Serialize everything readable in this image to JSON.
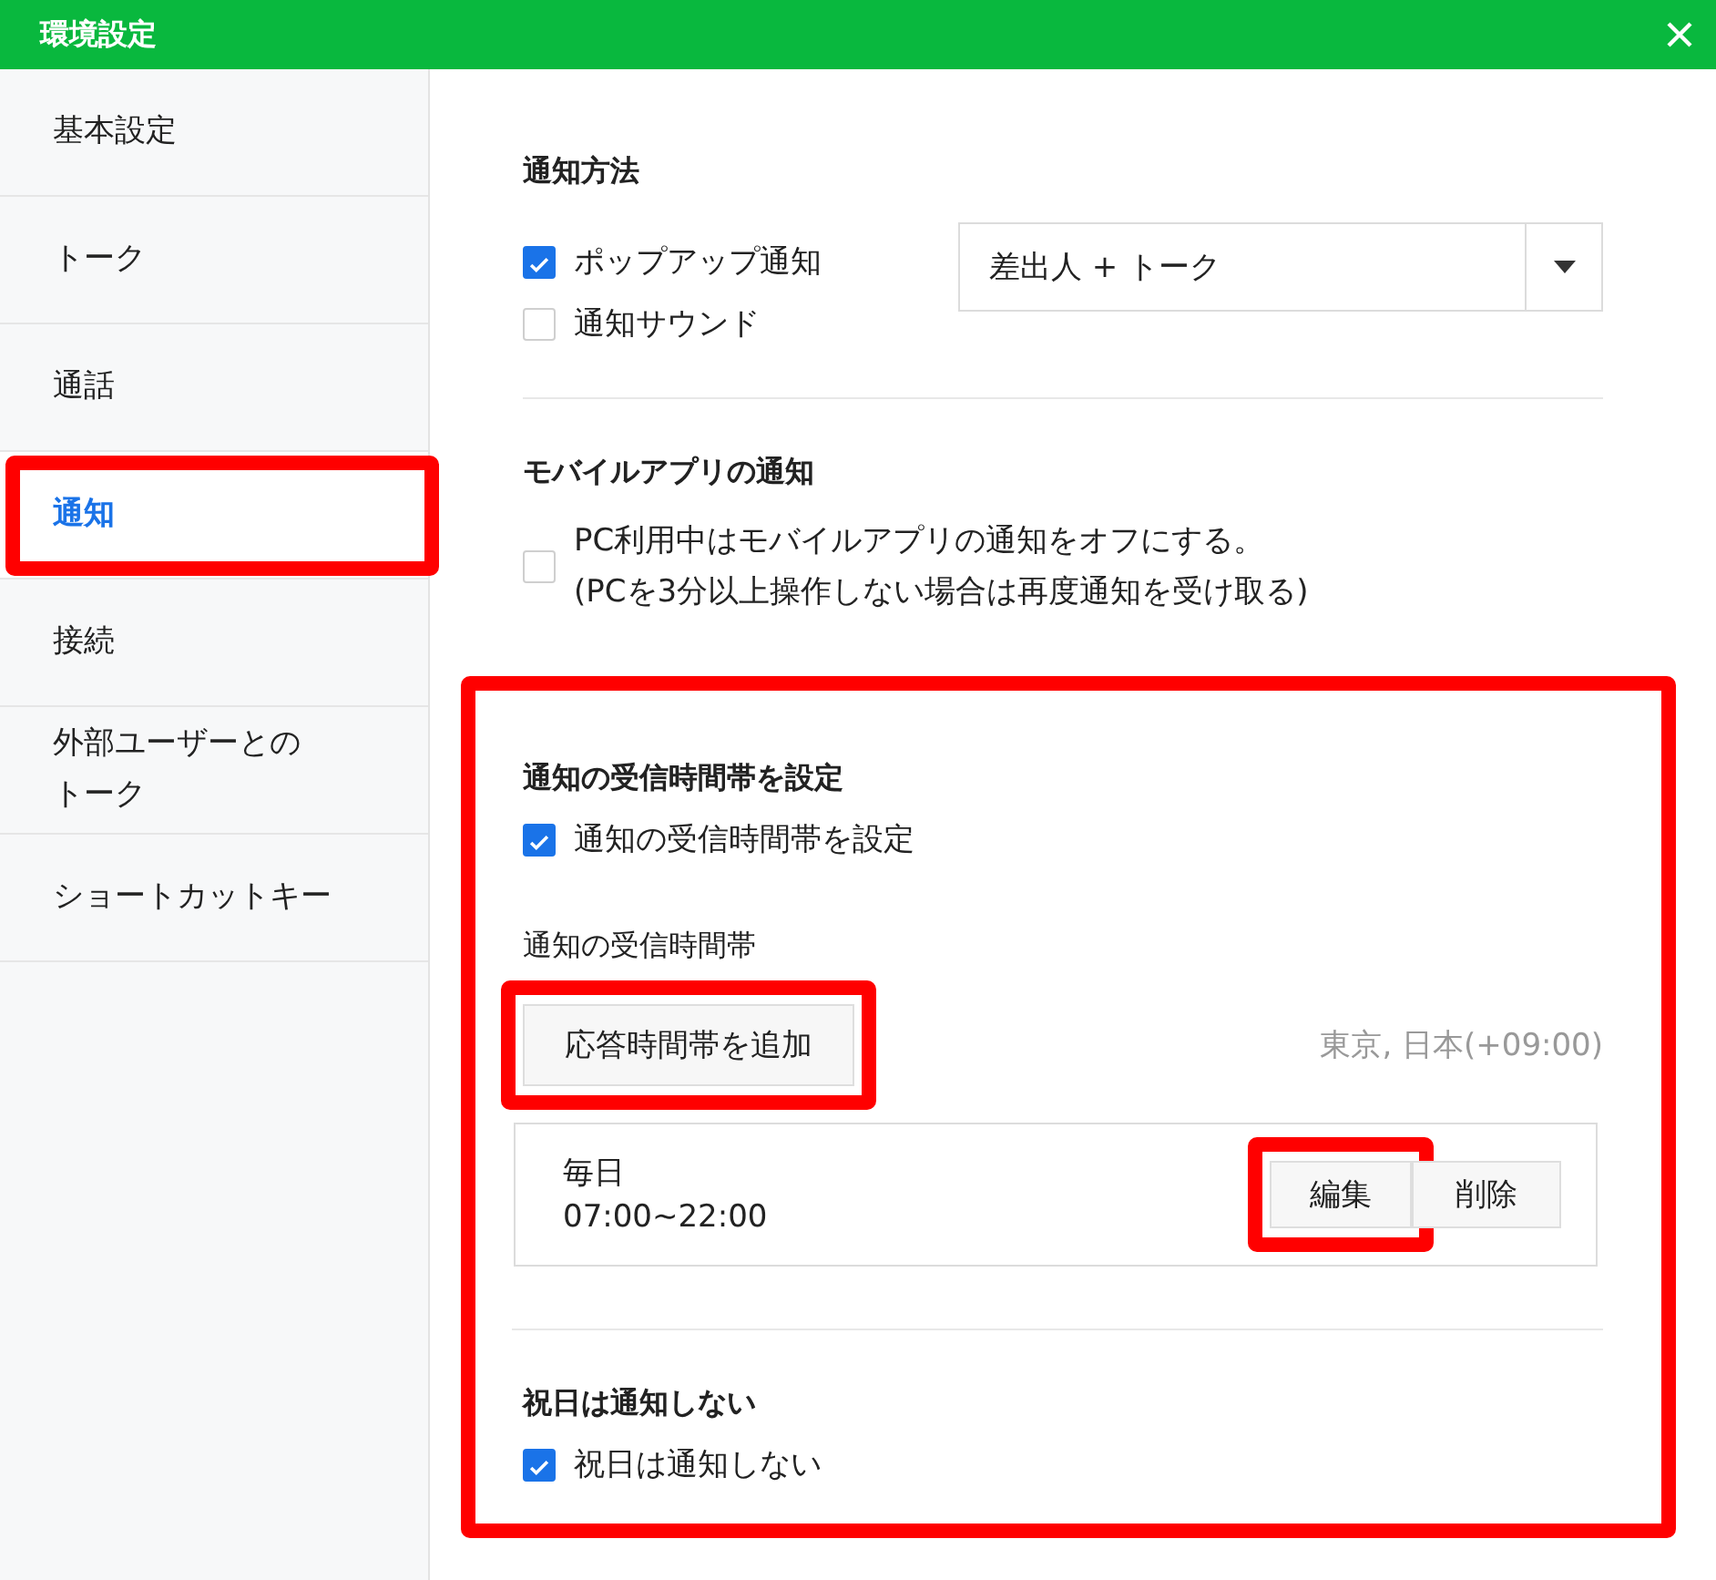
{
  "window": {
    "title": "環境設定"
  },
  "sidebar": {
    "items": [
      {
        "label": "基本設定",
        "selected": false,
        "highlighted": false
      },
      {
        "label": "トーク",
        "selected": false,
        "highlighted": false
      },
      {
        "label": "通話",
        "selected": false,
        "highlighted": false
      },
      {
        "label": "通知",
        "selected": true,
        "highlighted": true
      },
      {
        "label": "接続",
        "selected": false,
        "highlighted": false
      },
      {
        "label": "外部ユーザーとのトーク",
        "selected": false,
        "highlighted": false
      },
      {
        "label": "ショートカットキー",
        "selected": false,
        "highlighted": false
      }
    ]
  },
  "groups": [
    {
      "highlighted": false,
      "sections": [
        {
          "kind": "method",
          "title": "通知方法",
          "options": [
            {
              "label": "ポップアップ通知",
              "checked": true
            },
            {
              "label": "通知サウンド",
              "checked": false
            }
          ],
          "dropdown": {
            "value": "差出人 + トーク"
          }
        }
      ]
    },
    {
      "highlighted": false,
      "sections": [
        {
          "kind": "mobile",
          "title": "モバイルアプリの通知",
          "options": [
            {
              "lines": [
                "PC利用中はモバイルアプリの通知をオフにする。",
                "(PCを3分以上操作しない場合は再度通知を受け取る)"
              ],
              "checked": false
            }
          ]
        }
      ]
    },
    {
      "highlighted": true,
      "sections": [
        {
          "kind": "schedule",
          "title": "通知の受信時間帯を設定",
          "options": [
            {
              "label": "通知の受信時間帯を設定",
              "checked": true
            }
          ],
          "subtitle": "通知の受信時間帯",
          "add_button": {
            "label": "応答時間帯を追加",
            "highlighted": true
          },
          "timezone": "東京, 日本(+09:00)",
          "entries": [
            {
              "days": "毎日",
              "time": "07:00~22:00",
              "edit": {
                "label": "編集",
                "highlighted": true
              },
              "delete": {
                "label": "削除",
                "highlighted": false
              }
            }
          ]
        },
        {
          "kind": "holiday",
          "title": "祝日は通知しない",
          "options": [
            {
              "label": "祝日は通知しない",
              "checked": true
            }
          ]
        }
      ]
    }
  ]
}
